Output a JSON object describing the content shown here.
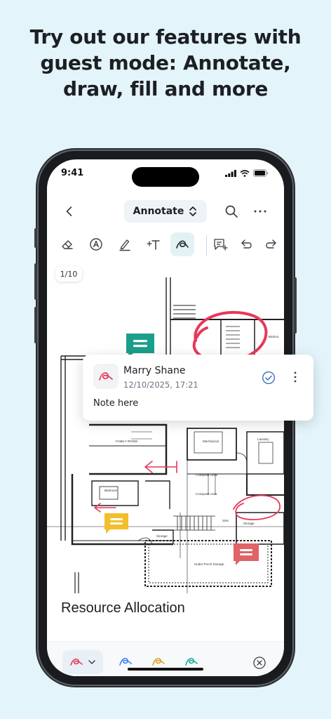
{
  "headline": {
    "line1": "Try out our features with",
    "line2": "guest mode: Annotate,",
    "line3": "draw, fill and more"
  },
  "status_bar": {
    "time": "9:41"
  },
  "nav": {
    "back_icon": "chevron-left-icon",
    "mode_label": "Annotate",
    "mode_icon": "chevron-up-down-icon",
    "search_icon": "search-icon",
    "more_icon": "ellipsis-icon"
  },
  "toolbar": {
    "tools": [
      "eraser",
      "stamp",
      "pen",
      "add-text",
      "draw",
      "add-comment",
      "undo",
      "redo"
    ],
    "active_tool": "draw"
  },
  "document": {
    "page_indicator": "1/10",
    "section_title": "Resource Allocation",
    "comment_colors": {
      "teal": "#1a9f8c",
      "yellow": "#f3be2b",
      "red": "#e06366"
    },
    "annotation_color": "#e8375a"
  },
  "note": {
    "author": "Marry Shane",
    "timestamp": "12/10/2025, 17:21",
    "text": "Note here"
  },
  "bottom_bar": {
    "selected_color": "#e8375a",
    "colors": [
      "#3b82f6",
      "#d9a21b",
      "#19a89a"
    ],
    "close_icon": "close-circle-icon"
  },
  "colors": {
    "background": "#e3f4fa",
    "accent": "#19a89a"
  }
}
